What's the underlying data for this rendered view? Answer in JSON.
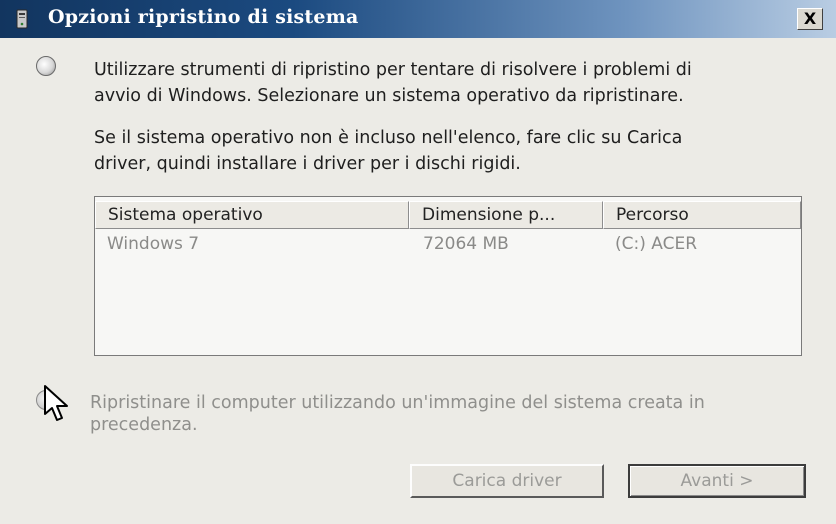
{
  "window": {
    "title": "Opzioni ripristino di sistema",
    "close_label": "X"
  },
  "option1": {
    "line1": "Utilizzare strumenti di ripristino per tentare di risolvere i problemi di",
    "line2": "avvio di Windows. Selezionare un sistema operativo da ripristinare."
  },
  "info": {
    "line1": "Se il sistema operativo non è incluso nell'elenco, fare clic su Carica",
    "line2": "driver, quindi installare i driver per i dischi rigidi."
  },
  "os_list": {
    "columns": [
      "Sistema operativo",
      "Dimensione p...",
      "Percorso"
    ],
    "rows": [
      [
        "Windows 7",
        "72064 MB",
        "(C:) ACER"
      ]
    ]
  },
  "option2": {
    "line1": "Ripristinare il computer utilizzando un'immagine del sistema creata in",
    "line2": "precedenza."
  },
  "buttons": {
    "load_driver": "Carica driver",
    "next": "Avanti >"
  },
  "colors": {
    "titlebar_start": "#12355f",
    "titlebar_end": "#b9cde3",
    "window_bg": "#ecebe6",
    "disabled_text": "#8f8f8c"
  }
}
